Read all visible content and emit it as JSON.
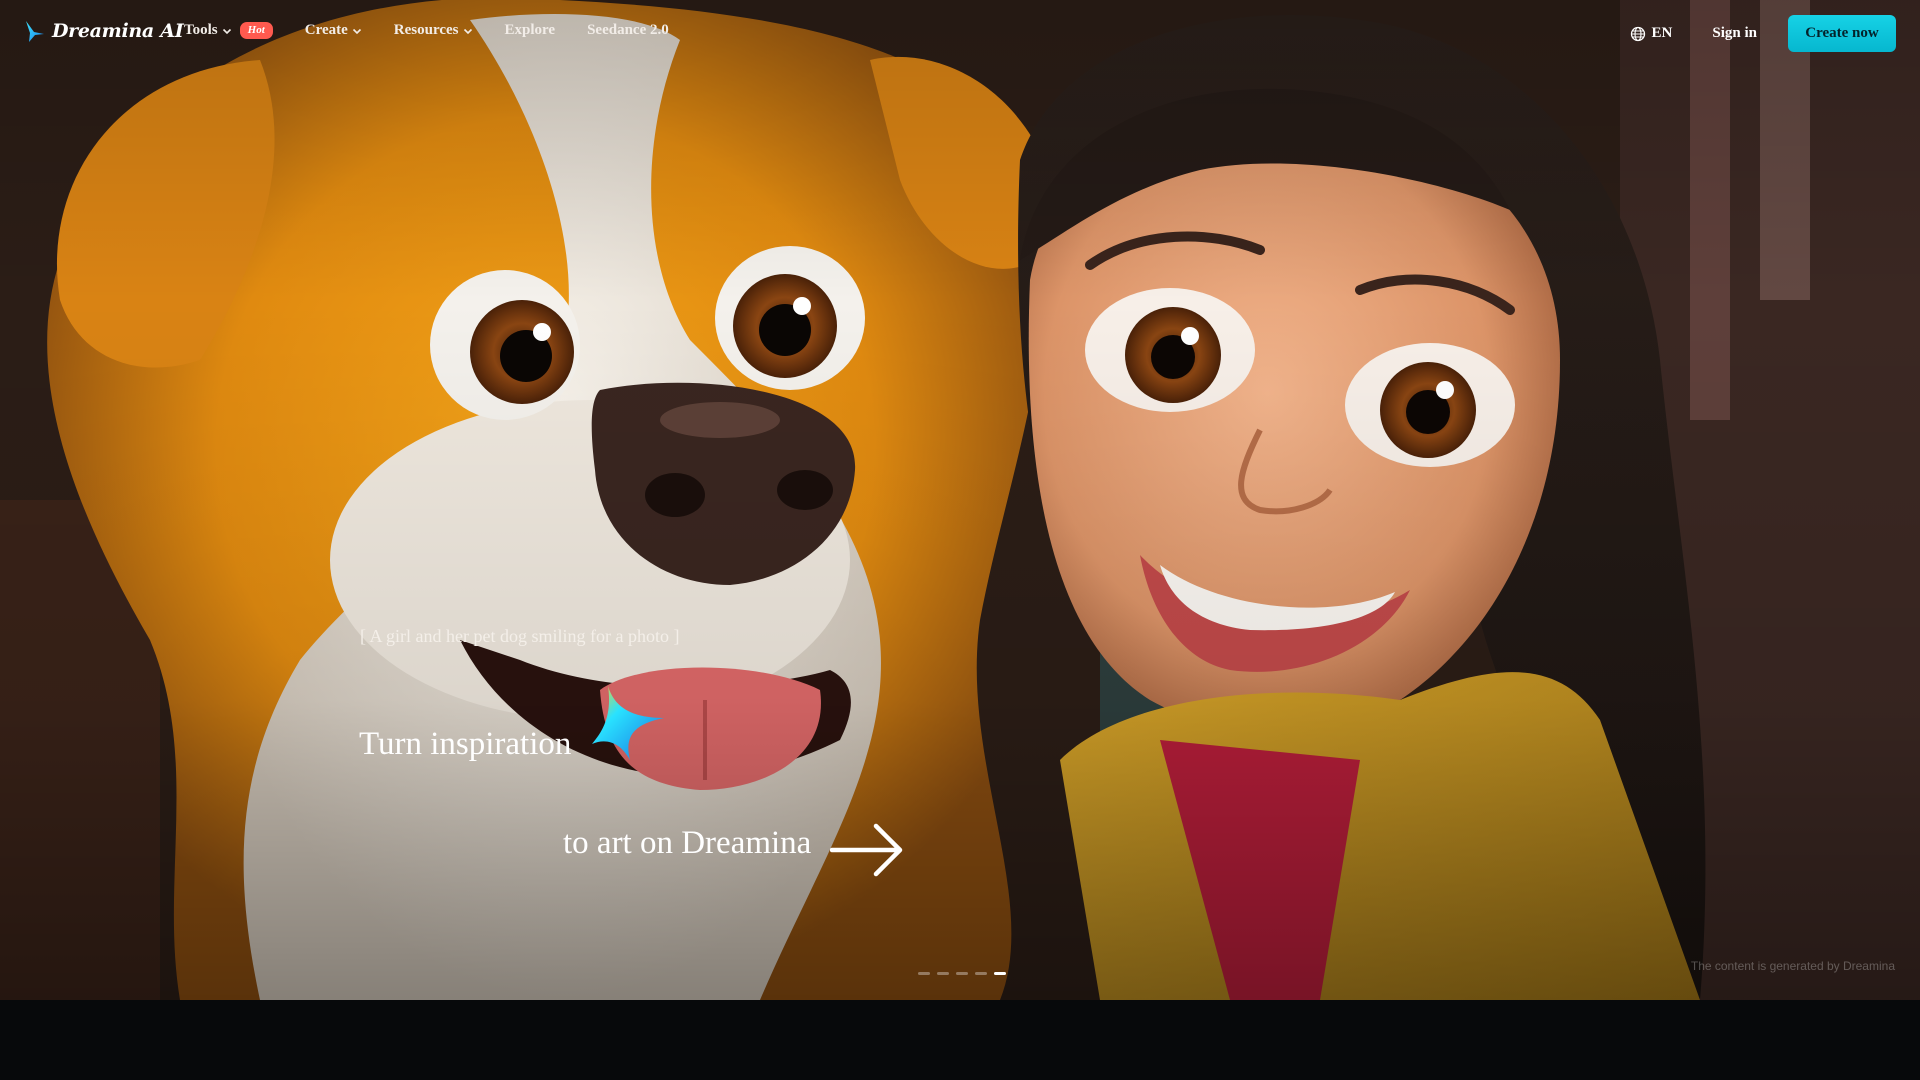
{
  "nav": {
    "logo_text": "Dreamina AI",
    "items": [
      {
        "label": "Tools",
        "has_dropdown": true,
        "badge": "Hot"
      },
      {
        "label": "Create",
        "has_dropdown": true
      },
      {
        "label": "Resources",
        "has_dropdown": true
      },
      {
        "label": "Explore",
        "has_dropdown": false
      },
      {
        "label": "Seedance 2.0",
        "has_dropdown": false
      }
    ],
    "language": "EN",
    "sign_in": "Sign in",
    "create_now": "Create now"
  },
  "hero": {
    "prompt": "[ A girl and her pet dog smiling for a photo ]",
    "headline_line1": "Turn inspiration",
    "headline_line2": "to art on Dreamina",
    "slides": {
      "count": 5,
      "active_index": 4
    },
    "disclaimer": "The content is generated by Dreamina"
  },
  "colors": {
    "accent": "#0ec5dc",
    "hot_badge": "#ff5a4f",
    "footer": "#07090b"
  },
  "icons": {
    "logo": "dreamina-star-icon",
    "language": "globe-icon",
    "dropdown": "chevron-down-icon",
    "cta": "arrow-right-icon",
    "brand_star": "four-point-star-icon"
  }
}
